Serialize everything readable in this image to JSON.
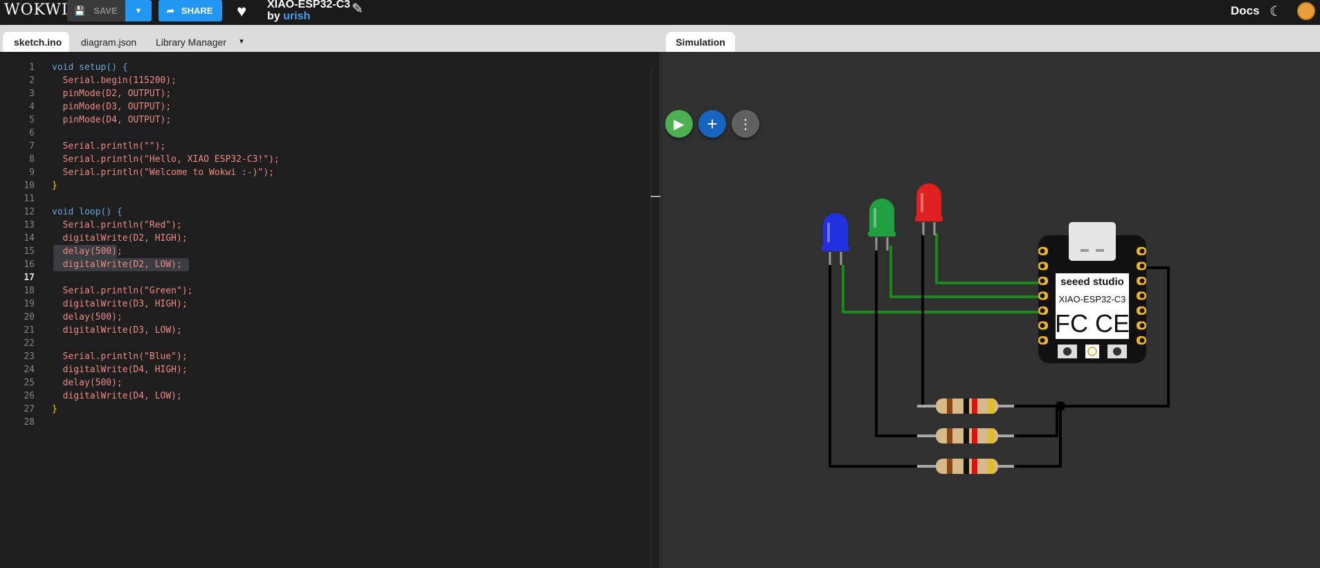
{
  "header": {
    "logo": "WOKWI",
    "save_label": "SAVE",
    "share_label": "SHARE",
    "project_title": "XIAO-ESP32-C3",
    "by_label": "by",
    "author": "urish",
    "docs_label": "Docs"
  },
  "tabs": {
    "items": [
      "sketch.ino",
      "diagram.json",
      "Library Manager"
    ],
    "active": "sketch.ino",
    "simulation": "Simulation"
  },
  "editor": {
    "current_line": 17,
    "lines": [
      "void setup() {",
      "  Serial.begin(115200);",
      "  pinMode(D2, OUTPUT);",
      "  pinMode(D3, OUTPUT);",
      "  pinMode(D4, OUTPUT);",
      "",
      "  Serial.println(\"\");",
      "  Serial.println(\"Hello, XIAO ESP32-C3!\");",
      "  Serial.println(\"Welcome to Wokwi :-)\");",
      "}",
      "",
      "void loop() {",
      "  Serial.println(\"Red\");",
      "  digitalWrite(D2, HIGH);",
      "  delay(500);",
      "  digitalWrite(D2, LOW);",
      "",
      "  Serial.println(\"Green\");",
      "  digitalWrite(D3, HIGH);",
      "  delay(500);",
      "  digitalWrite(D3, LOW);",
      "",
      "  Serial.println(\"Blue\");",
      "  digitalWrite(D4, HIGH);",
      "  delay(500);",
      "  digitalWrite(D4, LOW);",
      "}",
      ""
    ]
  },
  "board": {
    "brand": "seeed studio",
    "model": "XIAO-ESP32-C3",
    "marks": "FC CE"
  },
  "colors": {
    "accent": "#2196f3",
    "play": "#4caf50",
    "wire_signal": "#1a8a1a",
    "wire_gnd": "#000000",
    "led_red": "#e02020",
    "led_green": "#20a040",
    "led_blue": "#2030e0"
  }
}
